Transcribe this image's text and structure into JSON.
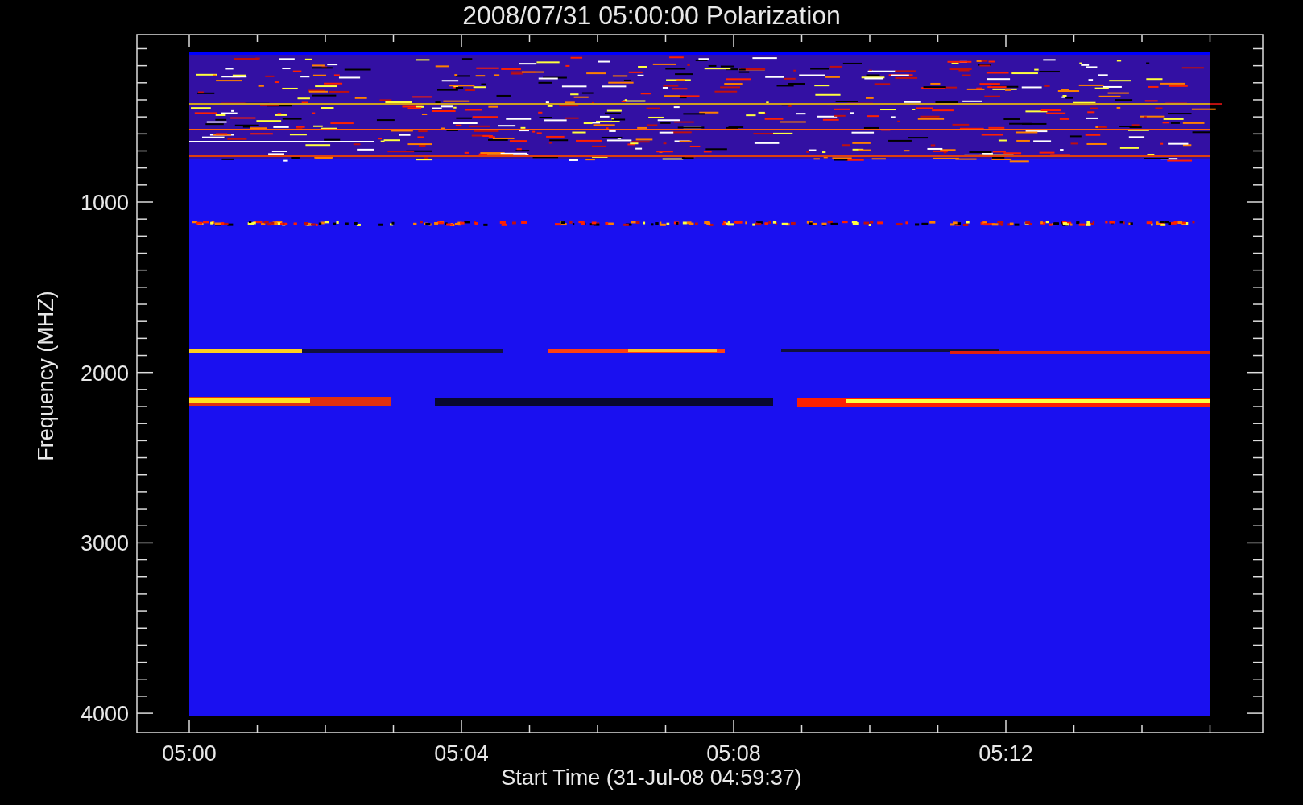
{
  "title": "2008/07/31 05:00:00 Polarization",
  "y_axis": {
    "label": "Frequency (MHZ)",
    "ticks": [
      "1000",
      "2000",
      "3000",
      "4000"
    ]
  },
  "x_axis": {
    "label": "Start Time (31-Jul-08 04:59:37)",
    "ticks": [
      "05:00",
      "05:04",
      "05:08",
      "05:12"
    ]
  }
}
